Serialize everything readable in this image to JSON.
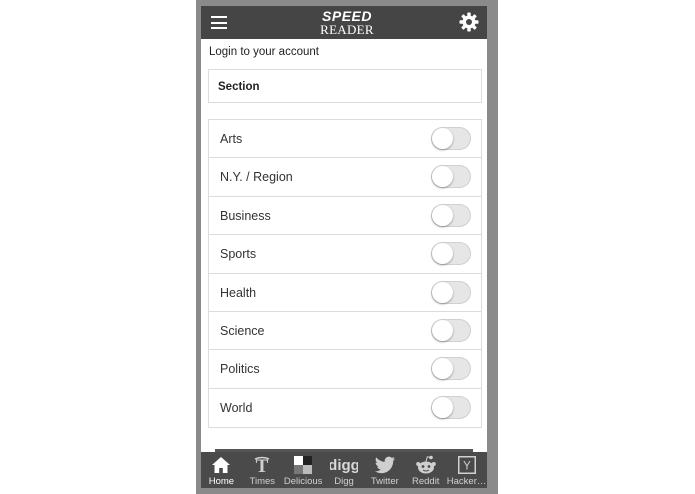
{
  "header": {
    "logo_line1": "SPEED",
    "logo_line2": "READER"
  },
  "login_link": "Login to your account",
  "section_label": "Section",
  "sections": [
    {
      "label": "Arts",
      "enabled": false
    },
    {
      "label": "N.Y. / Region",
      "enabled": false
    },
    {
      "label": "Business",
      "enabled": false
    },
    {
      "label": "Sports",
      "enabled": false
    },
    {
      "label": "Health",
      "enabled": false
    },
    {
      "label": "Science",
      "enabled": false
    },
    {
      "label": "Politics",
      "enabled": false
    },
    {
      "label": "World",
      "enabled": false
    }
  ],
  "tabs": [
    {
      "label": "Home",
      "icon": "home-icon",
      "active": true
    },
    {
      "label": "Times",
      "icon": "times-icon",
      "active": false
    },
    {
      "label": "Delicious",
      "icon": "delicious-icon",
      "active": false
    },
    {
      "label": "Digg",
      "icon": "digg-icon",
      "active": false
    },
    {
      "label": "Twitter",
      "icon": "twitter-icon",
      "active": false
    },
    {
      "label": "Reddit",
      "icon": "reddit-icon",
      "active": false
    },
    {
      "label": "Hacker…",
      "icon": "hacker-news-icon",
      "active": false
    }
  ],
  "colors": {
    "topbar": "#454545",
    "tabbar": "#4a4a4a",
    "phone_frame": "#8a8a8a"
  }
}
